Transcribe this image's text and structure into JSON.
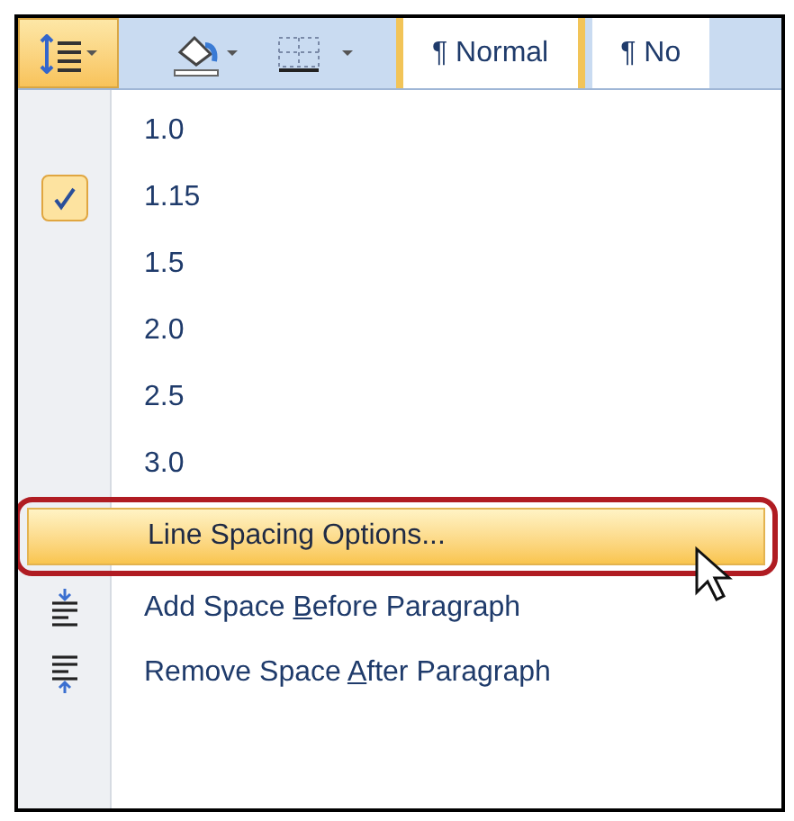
{
  "toolbar": {
    "styles": [
      {
        "label": "¶ Normal",
        "selected": true
      },
      {
        "label": "¶ No",
        "selected": false
      }
    ]
  },
  "menu": {
    "items": [
      {
        "kind": "spacing",
        "label": "1.0",
        "selected": false
      },
      {
        "kind": "spacing",
        "label": "1.15",
        "selected": true
      },
      {
        "kind": "spacing",
        "label": "1.5",
        "selected": false
      },
      {
        "kind": "spacing",
        "label": "2.0",
        "selected": false
      },
      {
        "kind": "spacing",
        "label": "2.5",
        "selected": false
      },
      {
        "kind": "spacing",
        "label": "3.0",
        "selected": false
      },
      {
        "kind": "command",
        "label": "Line Spacing Options...",
        "highlighted": true
      },
      {
        "kind": "add-before",
        "before": "Add Space ",
        "key": "B",
        "after": "efore Paragraph"
      },
      {
        "kind": "remove-after",
        "before": "Remove Space ",
        "key": "A",
        "after": "fter Paragraph"
      }
    ]
  }
}
